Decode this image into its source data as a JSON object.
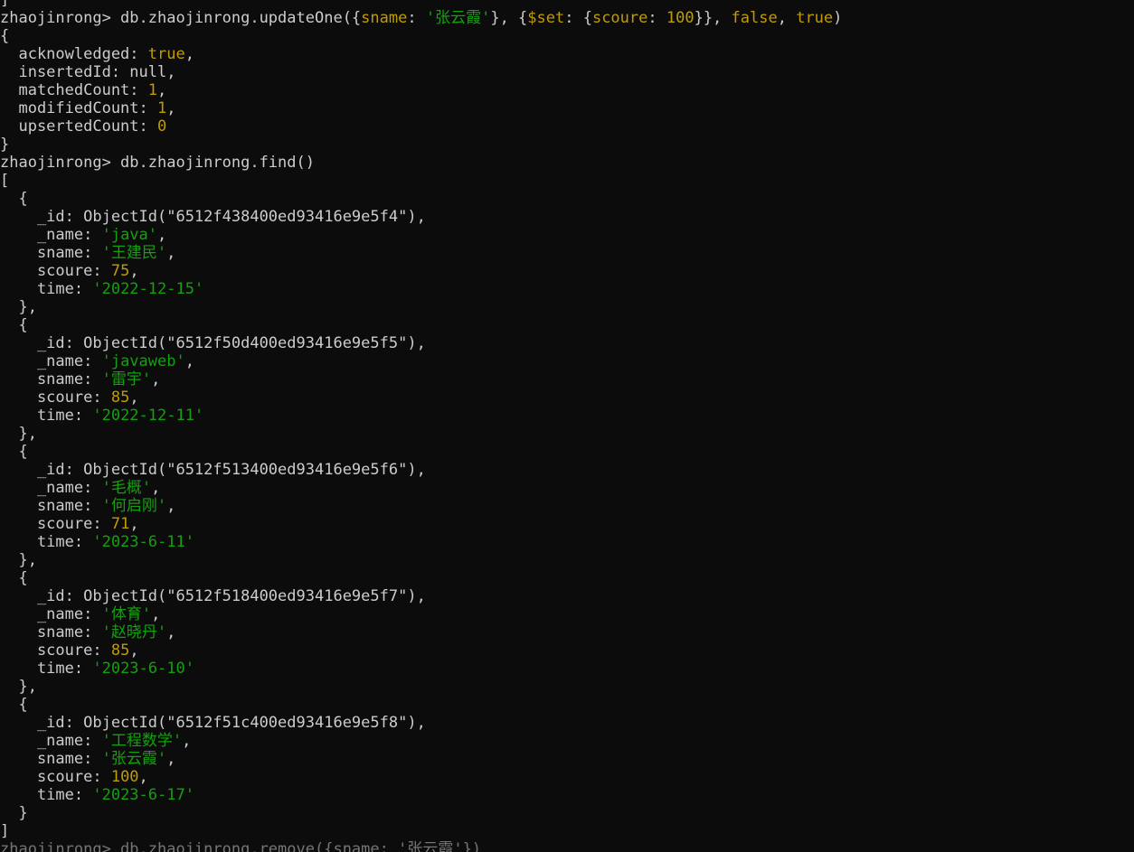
{
  "colors": {
    "background": "#0c0c0c",
    "default_text": "#cccccc",
    "string": "#13a10e",
    "literal": "#c19c00"
  },
  "terminal": {
    "lines": [
      [
        {
          "t": "]",
          "c": "default"
        }
      ],
      [
        {
          "t": "zhaojinrong> db.zhaojinrong.updateOne({",
          "c": "default"
        },
        {
          "t": "sname",
          "c": "yellow"
        },
        {
          "t": ": ",
          "c": "default"
        },
        {
          "t": "'张云霞'",
          "c": "green"
        },
        {
          "t": "}, {",
          "c": "default"
        },
        {
          "t": "$set",
          "c": "yellow"
        },
        {
          "t": ": {",
          "c": "default"
        },
        {
          "t": "scoure",
          "c": "yellow"
        },
        {
          "t": ": ",
          "c": "default"
        },
        {
          "t": "100",
          "c": "yellow"
        },
        {
          "t": "}}, ",
          "c": "default"
        },
        {
          "t": "false",
          "c": "yellow"
        },
        {
          "t": ", ",
          "c": "default"
        },
        {
          "t": "true",
          "c": "yellow"
        },
        {
          "t": ")",
          "c": "default"
        }
      ],
      [
        {
          "t": "{",
          "c": "default"
        }
      ],
      [
        {
          "t": "  acknowledged: ",
          "c": "default"
        },
        {
          "t": "true",
          "c": "yellow"
        },
        {
          "t": ",",
          "c": "default"
        }
      ],
      [
        {
          "t": "  insertedId: null,",
          "c": "default"
        }
      ],
      [
        {
          "t": "  matchedCount: ",
          "c": "default"
        },
        {
          "t": "1",
          "c": "yellow"
        },
        {
          "t": ",",
          "c": "default"
        }
      ],
      [
        {
          "t": "  modifiedCount: ",
          "c": "default"
        },
        {
          "t": "1",
          "c": "yellow"
        },
        {
          "t": ",",
          "c": "default"
        }
      ],
      [
        {
          "t": "  upsertedCount: ",
          "c": "default"
        },
        {
          "t": "0",
          "c": "yellow"
        }
      ],
      [
        {
          "t": "}",
          "c": "default"
        }
      ],
      [
        {
          "t": "zhaojinrong> db.zhaojinrong.find()",
          "c": "default"
        }
      ],
      [
        {
          "t": "[",
          "c": "default"
        }
      ],
      [
        {
          "t": "  {",
          "c": "default"
        }
      ],
      [
        {
          "t": "    _id: ObjectId(\"6512f438400ed93416e9e5f4\"),",
          "c": "default"
        }
      ],
      [
        {
          "t": "    _name: ",
          "c": "default"
        },
        {
          "t": "'java'",
          "c": "green"
        },
        {
          "t": ",",
          "c": "default"
        }
      ],
      [
        {
          "t": "    sname: ",
          "c": "default"
        },
        {
          "t": "'王建民'",
          "c": "green"
        },
        {
          "t": ",",
          "c": "default"
        }
      ],
      [
        {
          "t": "    scoure: ",
          "c": "default"
        },
        {
          "t": "75",
          "c": "yellow"
        },
        {
          "t": ",",
          "c": "default"
        }
      ],
      [
        {
          "t": "    time: ",
          "c": "default"
        },
        {
          "t": "'2022-12-15'",
          "c": "green"
        }
      ],
      [
        {
          "t": "  },",
          "c": "default"
        }
      ],
      [
        {
          "t": "  {",
          "c": "default"
        }
      ],
      [
        {
          "t": "    _id: ObjectId(\"6512f50d400ed93416e9e5f5\"),",
          "c": "default"
        }
      ],
      [
        {
          "t": "    _name: ",
          "c": "default"
        },
        {
          "t": "'javaweb'",
          "c": "green"
        },
        {
          "t": ",",
          "c": "default"
        }
      ],
      [
        {
          "t": "    sname: ",
          "c": "default"
        },
        {
          "t": "'雷宇'",
          "c": "green"
        },
        {
          "t": ",",
          "c": "default"
        }
      ],
      [
        {
          "t": "    scoure: ",
          "c": "default"
        },
        {
          "t": "85",
          "c": "yellow"
        },
        {
          "t": ",",
          "c": "default"
        }
      ],
      [
        {
          "t": "    time: ",
          "c": "default"
        },
        {
          "t": "'2022-12-11'",
          "c": "green"
        }
      ],
      [
        {
          "t": "  },",
          "c": "default"
        }
      ],
      [
        {
          "t": "  {",
          "c": "default"
        }
      ],
      [
        {
          "t": "    _id: ObjectId(\"6512f513400ed93416e9e5f6\"),",
          "c": "default"
        }
      ],
      [
        {
          "t": "    _name: ",
          "c": "default"
        },
        {
          "t": "'毛概'",
          "c": "green"
        },
        {
          "t": ",",
          "c": "default"
        }
      ],
      [
        {
          "t": "    sname: ",
          "c": "default"
        },
        {
          "t": "'何启刚'",
          "c": "green"
        },
        {
          "t": ",",
          "c": "default"
        }
      ],
      [
        {
          "t": "    scoure: ",
          "c": "default"
        },
        {
          "t": "71",
          "c": "yellow"
        },
        {
          "t": ",",
          "c": "default"
        }
      ],
      [
        {
          "t": "    time: ",
          "c": "default"
        },
        {
          "t": "'2023-6-11'",
          "c": "green"
        }
      ],
      [
        {
          "t": "  },",
          "c": "default"
        }
      ],
      [
        {
          "t": "  {",
          "c": "default"
        }
      ],
      [
        {
          "t": "    _id: ObjectId(\"6512f518400ed93416e9e5f7\"),",
          "c": "default"
        }
      ],
      [
        {
          "t": "    _name: ",
          "c": "default"
        },
        {
          "t": "'体育'",
          "c": "green"
        },
        {
          "t": ",",
          "c": "default"
        }
      ],
      [
        {
          "t": "    sname: ",
          "c": "default"
        },
        {
          "t": "'赵晓丹'",
          "c": "green"
        },
        {
          "t": ",",
          "c": "default"
        }
      ],
      [
        {
          "t": "    scoure: ",
          "c": "default"
        },
        {
          "t": "85",
          "c": "yellow"
        },
        {
          "t": ",",
          "c": "default"
        }
      ],
      [
        {
          "t": "    time: ",
          "c": "default"
        },
        {
          "t": "'2023-6-10'",
          "c": "green"
        }
      ],
      [
        {
          "t": "  },",
          "c": "default"
        }
      ],
      [
        {
          "t": "  {",
          "c": "default"
        }
      ],
      [
        {
          "t": "    _id: ObjectId(\"6512f51c400ed93416e9e5f8\"),",
          "c": "default"
        }
      ],
      [
        {
          "t": "    _name: ",
          "c": "default"
        },
        {
          "t": "'工程数学'",
          "c": "green"
        },
        {
          "t": ",",
          "c": "default"
        }
      ],
      [
        {
          "t": "    sname: ",
          "c": "default"
        },
        {
          "t": "'张云霞'",
          "c": "green"
        },
        {
          "t": ",",
          "c": "default"
        }
      ],
      [
        {
          "t": "    scoure: ",
          "c": "default"
        },
        {
          "t": "100",
          "c": "yellow"
        },
        {
          "t": ",",
          "c": "default"
        }
      ],
      [
        {
          "t": "    time: ",
          "c": "default"
        },
        {
          "t": "'2023-6-17'",
          "c": "green"
        }
      ],
      [
        {
          "t": "  }",
          "c": "default"
        }
      ],
      [
        {
          "t": "]",
          "c": "default"
        }
      ],
      [
        {
          "t": "zhaojinrong> db.zhaojinrong.remove({sname: '张云霞'})",
          "c": "partial"
        }
      ]
    ]
  }
}
